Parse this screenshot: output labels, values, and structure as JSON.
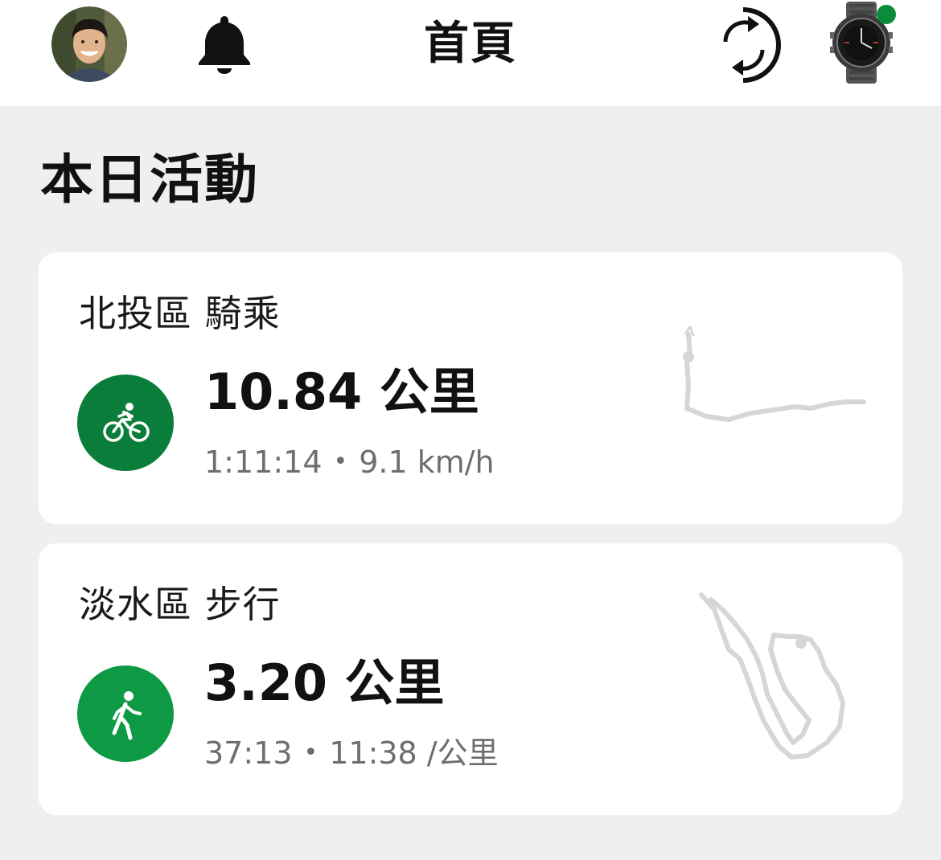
{
  "header": {
    "title": "首頁",
    "sync_status_color": "#0b8c3a"
  },
  "section": {
    "title": "本日活動"
  },
  "activities": [
    {
      "title": "北投區 騎乘",
      "type_icon": "bicycle-icon",
      "icon_color": "#0b7d3a",
      "distance": "10.84 公里",
      "duration": "1:11:14",
      "separator": "•",
      "pace": "9.1 km/h"
    },
    {
      "title": "淡水區 步行",
      "type_icon": "walking-icon",
      "icon_color": "#0e9a44",
      "distance": "3.20 公里",
      "duration": "37:13",
      "separator": "•",
      "pace": "11:38 /公里"
    }
  ],
  "colors": {
    "background": "#efefef",
    "card": "#ffffff",
    "route_map": "#d6d6d6",
    "secondary_text": "#6e6e6e"
  }
}
